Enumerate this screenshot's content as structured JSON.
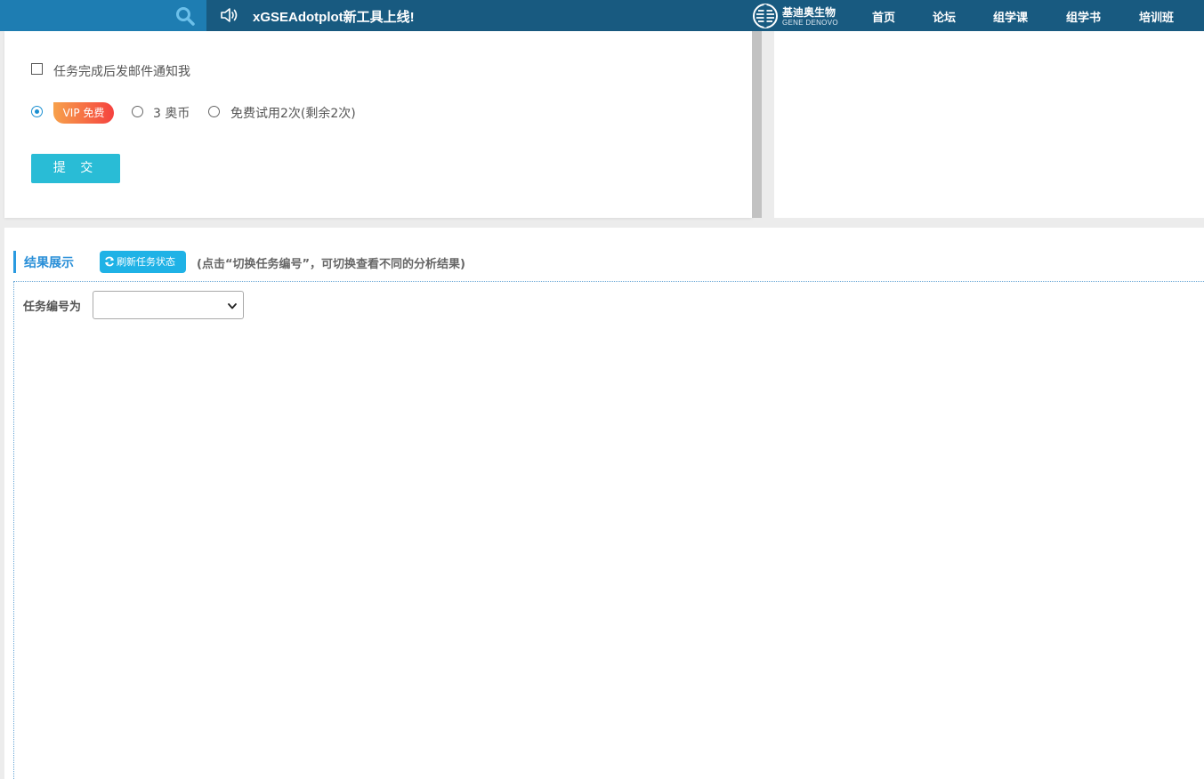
{
  "header": {
    "announcement": "xGSEAdotplot新工具上线!",
    "logo_cn": "基迪奥生物",
    "logo_en": "GENE DENOVO",
    "nav": [
      "首页",
      "论坛",
      "组学课",
      "组学书",
      "培训班"
    ],
    "colors": {
      "bar": "#185a80",
      "search_box": "#1e7db2"
    }
  },
  "form": {
    "notify_label": "任务完成后发邮件通知我",
    "notify_checked": false,
    "vip_badge": "VIP 免费",
    "option_coins": "3 奥币",
    "option_trial": "免费试用2次(剩余2次)",
    "selected_option": "vip",
    "submit_label": "提 交"
  },
  "results": {
    "title": "结果展示",
    "refresh_label": "刷新任务状态",
    "hint": "(点击“切换任务编号”，可切换查看不同的分析结果)",
    "task_label": "任务编号为",
    "task_value": ""
  },
  "icons": {
    "search": "search-icon",
    "announcement": "speaker-icon",
    "refresh": "refresh-icon",
    "select": "chevron-down-icon"
  }
}
